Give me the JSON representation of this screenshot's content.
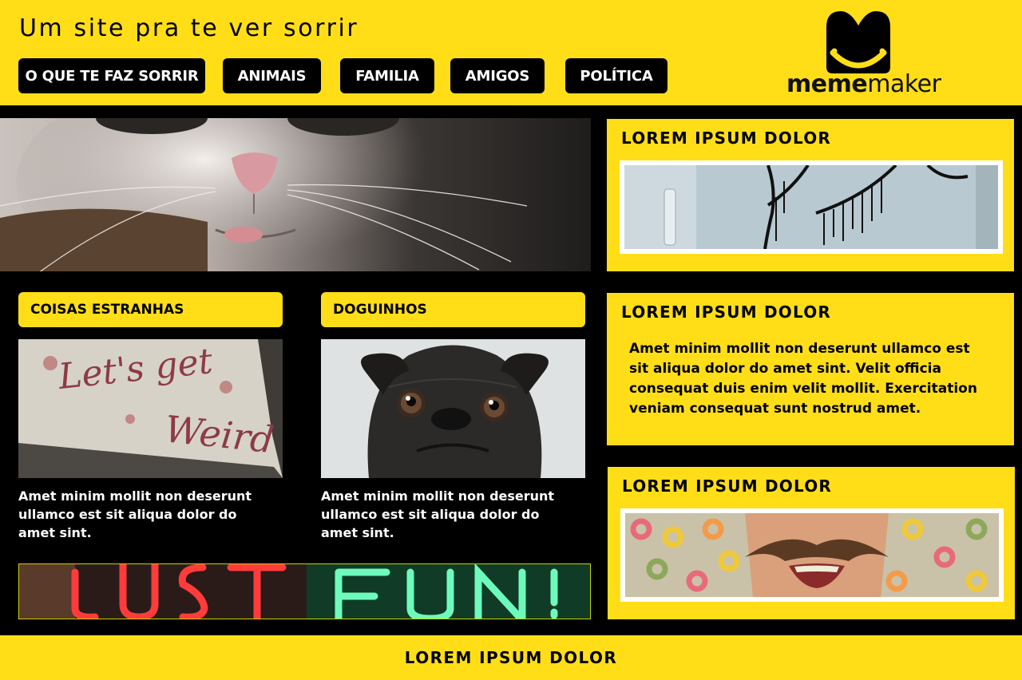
{
  "header": {
    "title": "Um site pra te ver sorrir",
    "nav": [
      {
        "label": "O QUE TE FAZ SORRIR"
      },
      {
        "label": "ANIMAIS"
      },
      {
        "label": "FAMILIA"
      },
      {
        "label": "AMIGOS"
      },
      {
        "label": "POLÍTICA"
      }
    ],
    "logo": {
      "text_bold": "meme",
      "text_light": "maker"
    }
  },
  "main": {
    "hero": {
      "description": "cat-closeup-image"
    },
    "cards": [
      {
        "label": "COISAS ESTRANHAS",
        "image_text": "Let's get Weird",
        "text": "Amet minim mollit non deserunt ullamco est sit aliqua dolor do amet sint."
      },
      {
        "label": "DOGUINHOS",
        "text": "Amet minim mollit non deserunt ullamco est sit aliqua dolor do amet sint."
      }
    ],
    "banner": {
      "image_text": "JUST FUN!"
    }
  },
  "sidebar": {
    "boxes": [
      {
        "title": "LOREM IPSUM DOLOR"
      },
      {
        "title": "LOREM IPSUM DOLOR",
        "text": "Amet minim mollit non deserunt ullamco est sit aliqua dolor do amet sint. Velit officia consequat duis enim velit mollit. Exercitation veniam consequat sunt nostrud amet."
      },
      {
        "title": "LOREM IPSUM DOLOR"
      }
    ]
  },
  "footer": {
    "label": "LOREM IPSUM DOLOR"
  },
  "colors": {
    "accent": "#FFDE17",
    "background": "#000000"
  }
}
